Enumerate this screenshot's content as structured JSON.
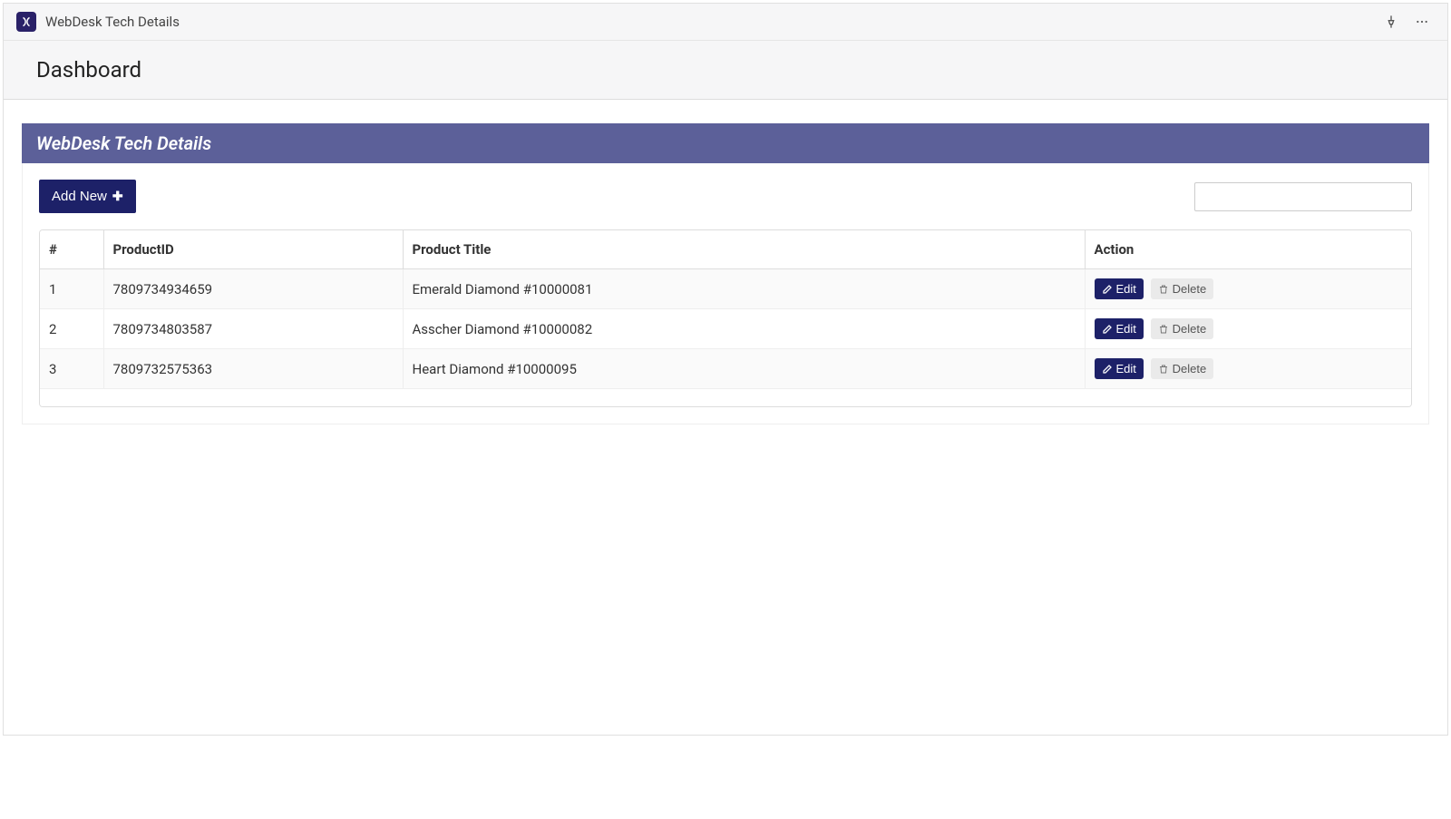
{
  "titlebar": {
    "app_title": "WebDesk Tech Details"
  },
  "subheader": {
    "page_title": "Dashboard"
  },
  "panel": {
    "heading": "WebDesk Tech Details",
    "add_new_label": "Add New",
    "search_value": "",
    "columns": {
      "index": "#",
      "product_id": "ProductID",
      "product_title": "Product Title",
      "action": "Action"
    },
    "action_labels": {
      "edit": "Edit",
      "delete": "Delete"
    },
    "rows": [
      {
        "index": "1",
        "product_id": "7809734934659",
        "product_title": "Emerald Diamond #10000081"
      },
      {
        "index": "2",
        "product_id": "7809734803587",
        "product_title": "Asscher Diamond #10000082"
      },
      {
        "index": "3",
        "product_id": "7809732575363",
        "product_title": "Heart Diamond #10000095"
      }
    ]
  }
}
